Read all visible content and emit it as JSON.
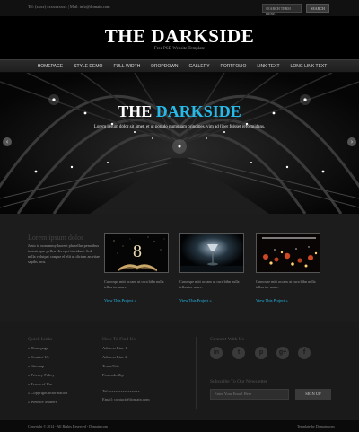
{
  "topbar": {
    "contact": "Tel: (xxxx) xxxxxxxxxx | Mail: info@domain.com",
    "search_placeholder": "SEARCH TERM HERE",
    "search_button": "SEARCH"
  },
  "header": {
    "logo": "THE DARKSIDE",
    "tagline": "Free PSD Website Template"
  },
  "nav": {
    "items": [
      "HOMEPAGE",
      "STYLE DEMO",
      "FULL WIDTH",
      "DROPDOWN",
      "GALLERY",
      "PORTFOLIO",
      "LINK TEXT",
      "LONG LINK TEXT"
    ]
  },
  "hero": {
    "title_main": "THE",
    "title_accent": "DARKSIDE",
    "subtitle": "Lorem ipsum dolor sit amet, et ut populo numquam principes, vim ad liber fuisset reformidans.",
    "prev_arrow": "‹",
    "next_arrow": "›"
  },
  "intro": {
    "title": "Lorem ipsum dolor",
    "text": "Justo id nonummy laoreet phasellus penatibus in antesque pellen elis eget tincidunt. Sed nulla volutpat congue el elit ut dictum an vitae sapibs arcu."
  },
  "cards": [
    {
      "desc": "Curoospe mitt accans ut cura bibn nulla tellus tor amec.",
      "link": "View This Project »"
    },
    {
      "desc": "Curoospe mitt accans ut cura bibn nulla tellus tor amec.",
      "link": "View This Project »"
    },
    {
      "desc": "Curoospe mitt accans ut cura bibn nulla tellus tor amec.",
      "link": "View This Project »"
    }
  ],
  "footer": {
    "quick_links_title": "Quick Links",
    "quick_links": [
      "» Homepage",
      "» Contact Us",
      "» Sitemap",
      "» Privacy Policy",
      "» Terms of Use",
      "» Copyright Information",
      "» Website Matters"
    ],
    "find_us_title": "How To Find Us",
    "address": [
      "Address Line 1",
      "Address Line 2",
      "Town/City",
      "Postcode/Zip"
    ],
    "tel": "Tel: xxxx xxxx xxxxxx",
    "email": "Email: contact@domain.com",
    "connect_title": "Connect With Us",
    "social": [
      "in",
      "t",
      "p",
      "g+",
      "f"
    ],
    "newsletter_title": "Subscribe To Our Newsletter",
    "newsletter_placeholder": "Enter Your Email Here",
    "newsletter_button": "SIGN UP"
  },
  "bottom": {
    "copyright": "Copyright © 2014 - All Rights Reserved - Domain.com",
    "credit": "Template by Domain.com"
  },
  "colors": {
    "accent": "#27b9e8",
    "background": "#1b1b1b"
  }
}
